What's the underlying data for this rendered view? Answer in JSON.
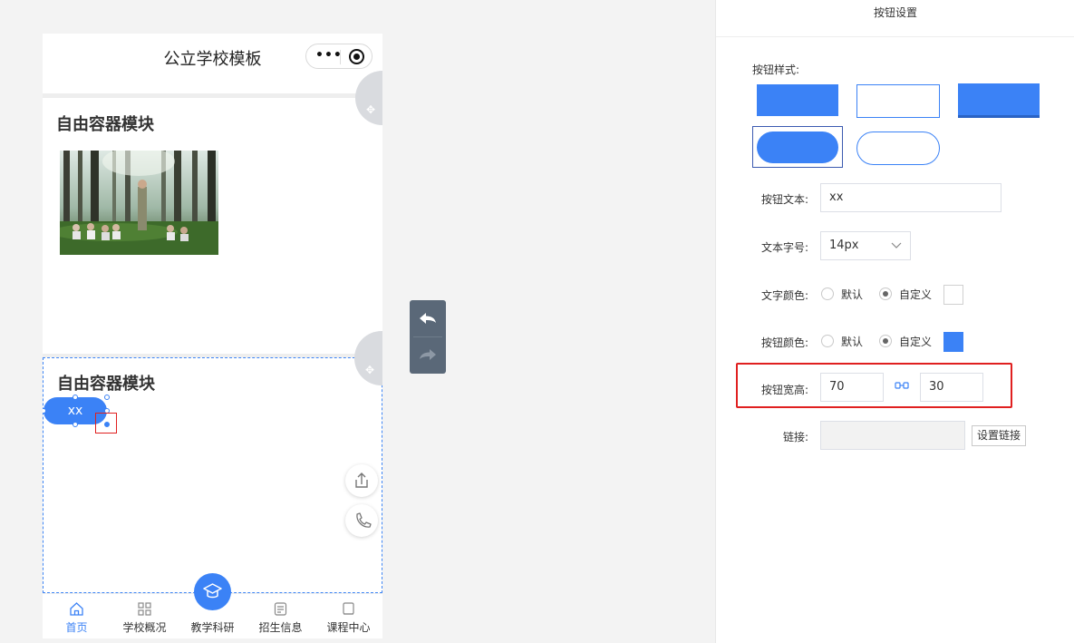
{
  "phone": {
    "nav_title": "公立学校模板",
    "capsule_menu_icon": "more-dots-icon",
    "capsule_close_icon": "target-circle-icon",
    "modules": [
      {
        "title": "自由容器模块",
        "image": "forest-children-photo"
      },
      {
        "title": "自由容器模块",
        "button_text": "xx"
      }
    ],
    "float_buttons": [
      "share-icon",
      "phone-icon"
    ],
    "tabbar": {
      "items": [
        {
          "label": "首页",
          "icon": "home-icon",
          "active": true
        },
        {
          "label": "学校概况",
          "icon": "grid-icon",
          "active": false
        },
        {
          "label": "教学科研",
          "icon": "graduation-cap-icon",
          "active": false
        },
        {
          "label": "招生信息",
          "icon": "document-icon",
          "active": false
        },
        {
          "label": "课程中心",
          "icon": "book-icon",
          "active": false
        }
      ]
    }
  },
  "toolbar": {
    "undo_icon": "undo-icon",
    "redo_icon": "redo-icon"
  },
  "settings": {
    "title": "按钮设置",
    "style_label": "按钮样式:",
    "text_label": "按钮文本:",
    "text_value": "xx",
    "font_size_label": "文本字号:",
    "font_size_value": "14px",
    "text_color_label": "文字颜色:",
    "button_color_label": "按钮颜色:",
    "option_default": "默认",
    "option_custom": "自定义",
    "text_color_value": "#ffffff",
    "button_color_value": "#3b82f6",
    "size_label": "按钮宽高:",
    "width_value": "70",
    "height_value": "30",
    "link_label": "链接:",
    "link_value": "",
    "link_button": "设置链接"
  },
  "colors": {
    "accent": "#3b82f6",
    "highlight": "#e02020"
  }
}
